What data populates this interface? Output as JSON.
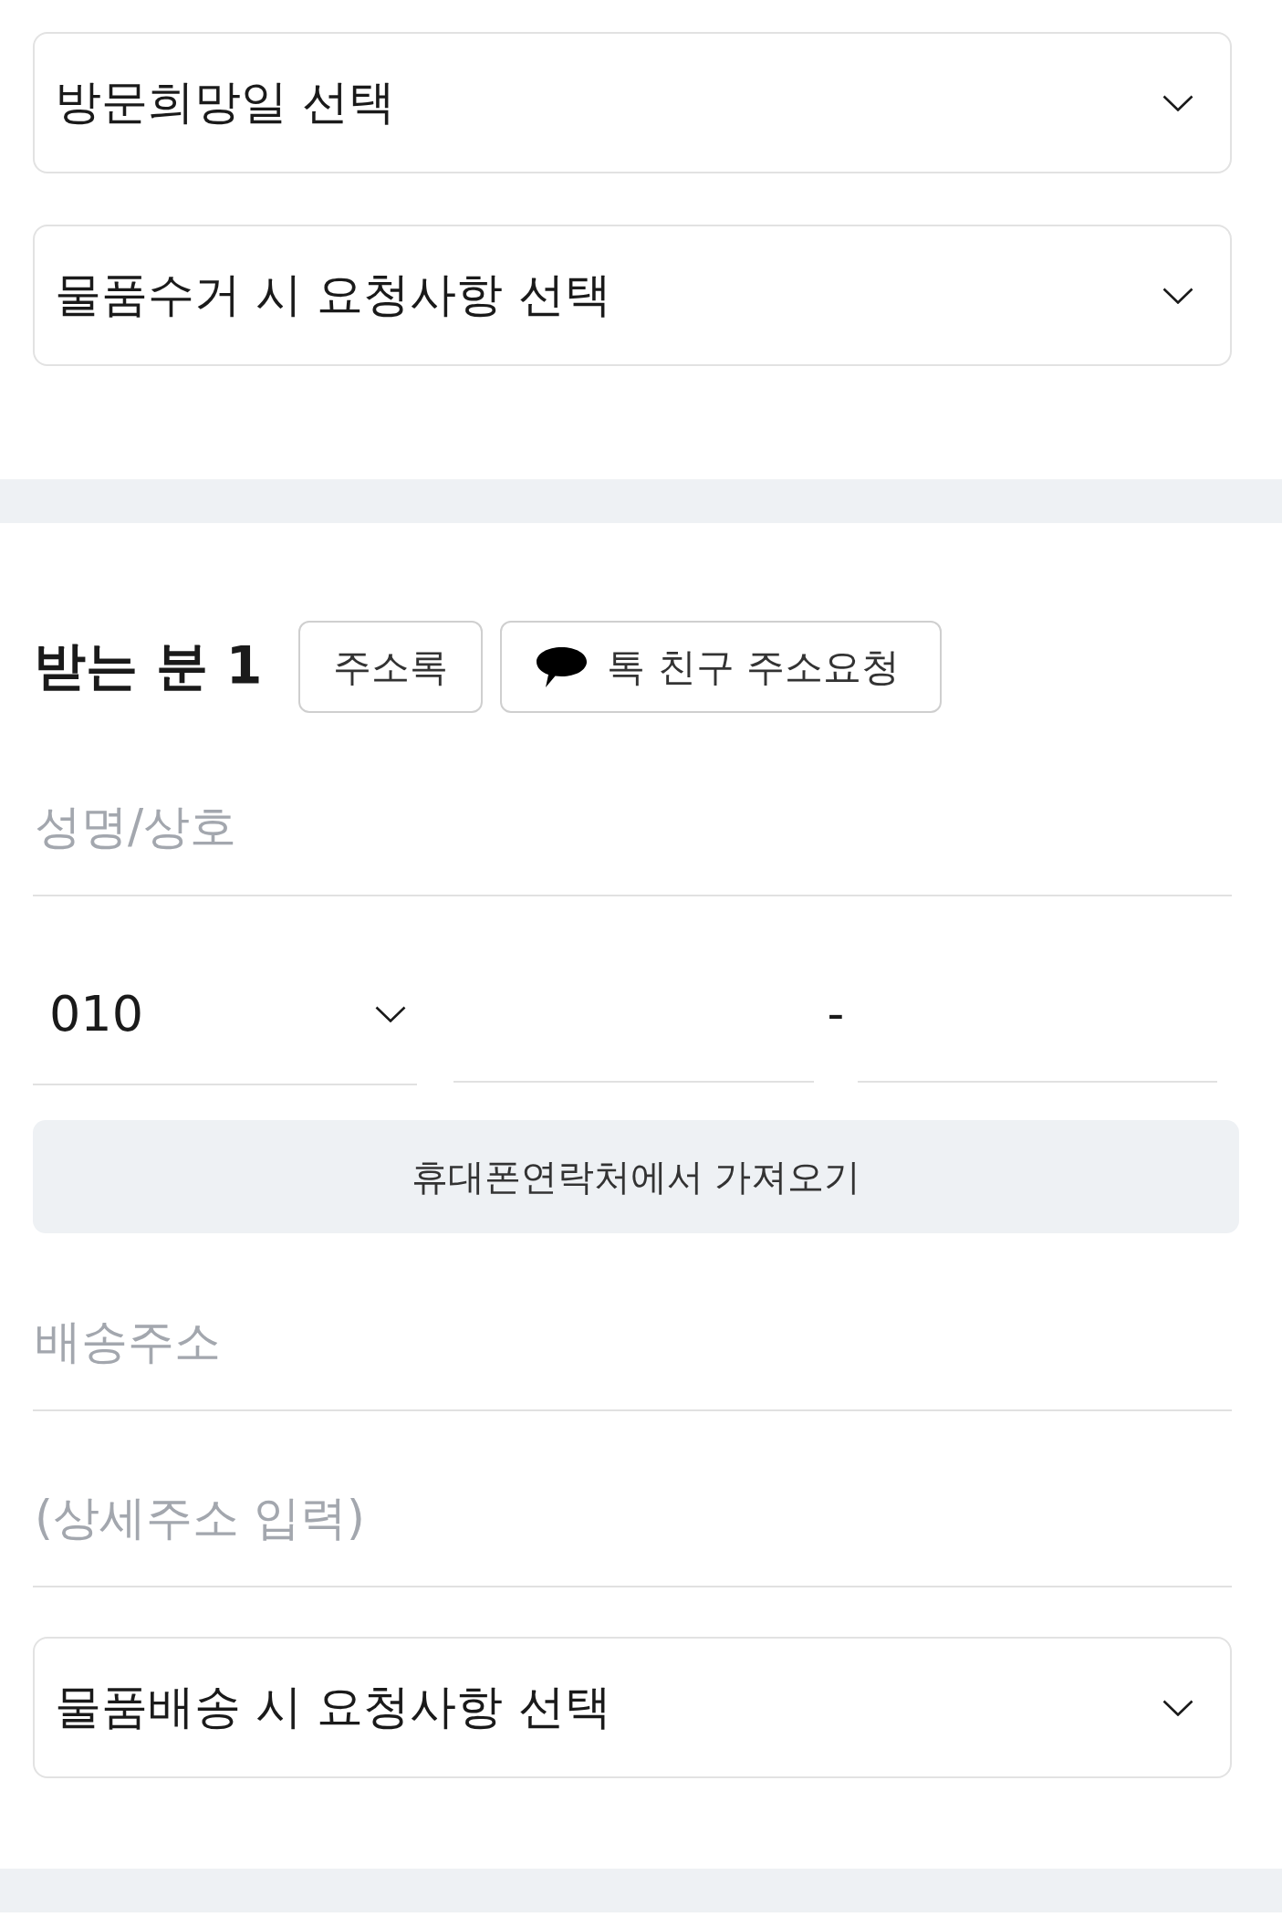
{
  "pickup": {
    "selects": [
      {
        "label": "방문희망일 선택"
      },
      {
        "label": "물품수거 시 요청사항 선택"
      }
    ]
  },
  "recipient": {
    "title": "받는 분 1",
    "buttons": [
      {
        "kind": "plain",
        "label": "주소록"
      },
      {
        "kind": "talk",
        "label": "톡 친구 주소요청"
      }
    ],
    "name_field": {
      "placeholder": "성명/상호"
    },
    "phone": {
      "prefix": "010",
      "separator": "-"
    },
    "contacts_button": "휴대폰연락처에서 가져오기",
    "address_field": {
      "placeholder": "배송주소"
    },
    "detail_field": {
      "placeholder": "(상세주소 입력)"
    },
    "delivery_select": {
      "label": "물품배송 시 요청사항 선택"
    }
  }
}
